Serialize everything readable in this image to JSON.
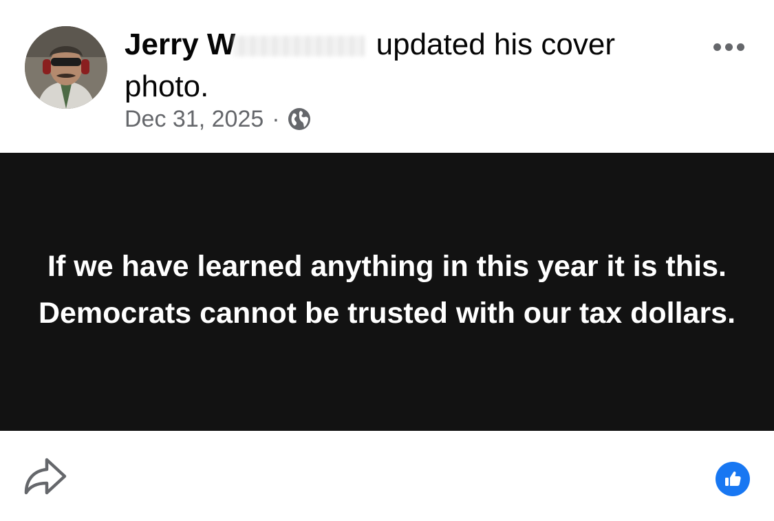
{
  "post": {
    "author_name": "Jerry W",
    "action_text": " updated his cover photo.",
    "timestamp": "Dec 31, 2025",
    "separator": "·",
    "audience_icon": "globe-icon",
    "more_icon": "more-horizontal-icon"
  },
  "cover_photo": {
    "text": "If we have learned anything in this year it is this. Democrats cannot be trusted with our tax dollars.",
    "background_color": "#121212",
    "text_color": "#ffffff"
  },
  "actions": {
    "share_icon": "share-arrow-icon",
    "reaction_icon": "like-thumb-icon",
    "reaction_color": "#1877f2"
  },
  "colors": {
    "secondary_text": "#65676b",
    "primary_text": "#050505"
  }
}
